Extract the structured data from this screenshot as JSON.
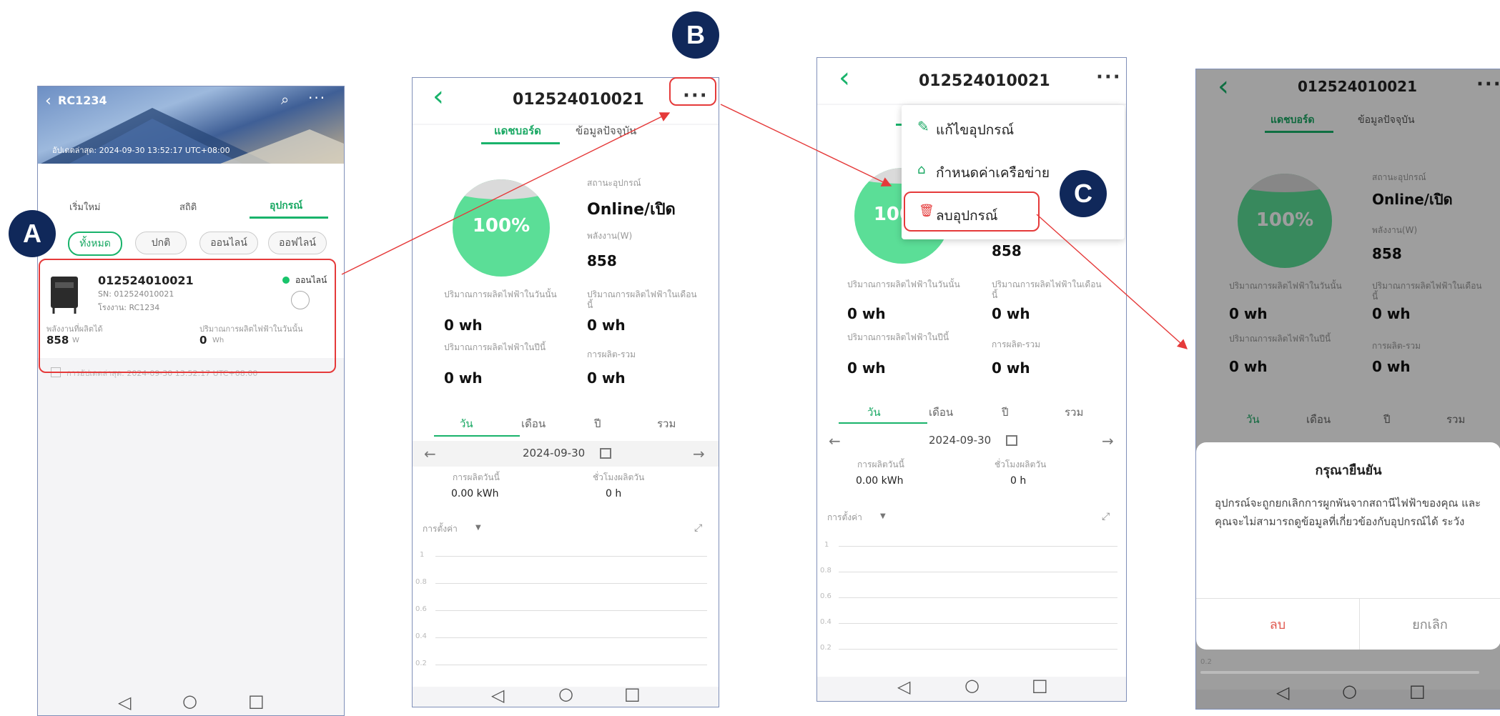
{
  "markers": {
    "a": "A",
    "b": "B",
    "c": "C"
  },
  "screen1": {
    "header_title": "RC1234",
    "last_update": "อัปเดตล่าสุด: 2024-09-30 13:52:17 UTC+08:00",
    "main_tabs": [
      "เริ่มใหม่",
      "สถิติ",
      "อุปกรณ์"
    ],
    "filters": [
      "ทั้งหมด",
      "ปกติ",
      "ออนไลน์",
      "ออฟไลน์"
    ],
    "device": {
      "name": "012524010021",
      "sn": "SN: 012524010021",
      "plant": "โรงงาน: RC1234",
      "status": "ออนไลน์",
      "power_label": "พลังงานที่ผลิตได้",
      "power_value": "858",
      "power_unit": "W",
      "today_label": "ปริมาณการผลิตไฟฟ้าในวันนั้น",
      "today_value": "0",
      "today_unit": "Wh",
      "update_text": "การอัปเดตล่าสุด: 2024-09-30 13:52:17 UTC+08:00"
    }
  },
  "device_screen": {
    "title": "012524010021",
    "tabs": [
      "แดชบอร์ด",
      "ข้อมูลปัจจุบัน"
    ],
    "percent": "100%",
    "status_label": "สถานะอุปกรณ์",
    "status_value": "Online/เปิด",
    "power_label": "พลังงาน(W)",
    "power_value": "858",
    "today_label": "ปริมาณการผลิตไฟฟ้าในวันนั้น",
    "today_value": "0 wh",
    "month_label": "ปริมาณการผลิตไฟฟ้าในเดือนนี้",
    "month_value": "0 wh",
    "year_label": "ปริมาณการผลิตไฟฟ้าในปีนี้",
    "year_value": "0 wh",
    "total_label": "การผลิต-รวม",
    "total_value": "0 wh",
    "period_tabs": [
      "วัน",
      "เดือน",
      "ปี",
      "รวม"
    ],
    "date": "2024-09-30",
    "day_prod_label": "การผลิตวันนี้",
    "day_prod_value": "0.00 kWh",
    "hours_label": "ชั่วโมงผลิตวัน",
    "hours_value": "0 h",
    "settings_label": "การตั้งค่า",
    "y_ticks": [
      "1",
      "0.8",
      "0.6",
      "0.4",
      "0.2"
    ]
  },
  "menu": {
    "edit": "แก้ไขอุปกรณ์",
    "network": "กำหนดค่าเครือข่าย",
    "delete": "ลบอุปกรณ์"
  },
  "dialog": {
    "title": "กรุณายืนยัน",
    "message": "อุปกรณ์จะถูกยกเลิกการผูกพันจากสถานีไฟฟ้าของคุณ และคุณจะไม่สามารถดูข้อมูลที่เกี่ยวข้องกับอุปกรณ์ได้ ระวัง",
    "confirm": "ลบ",
    "cancel": "ยกเลิก",
    "tick_label": "0.2"
  }
}
